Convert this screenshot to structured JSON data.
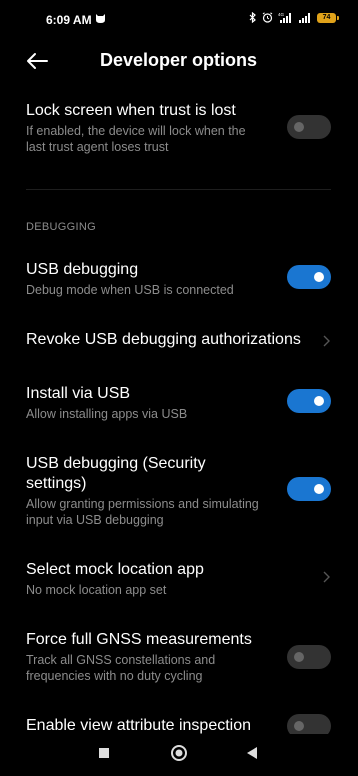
{
  "status_bar": {
    "time": "6:09 AM",
    "battery_level": "74",
    "icons": [
      "notification-icon",
      "bluetooth-icon",
      "alarm-icon",
      "signal-4g-icon",
      "signal-icon",
      "battery-icon"
    ]
  },
  "header": {
    "title": "Developer options",
    "back_icon": "arrow-left-icon"
  },
  "settings": {
    "lock_screen": {
      "title": "Lock screen when trust is lost",
      "subtitle_line1": "If enabled, the device will lock when the",
      "subtitle_line2": "last trust agent loses trust",
      "enabled": false
    },
    "section_debugging": "DEBUGGING",
    "usb_debugging": {
      "title": "USB debugging",
      "subtitle": "Debug mode when USB is connected",
      "enabled": true
    },
    "revoke_usb": {
      "title": "Revoke USB debugging authorizations"
    },
    "install_via_usb": {
      "title": "Install via USB",
      "subtitle": "Allow installing apps via USB",
      "enabled": true
    },
    "usb_debugging_security": {
      "title_line1": "USB debugging (Security",
      "title_line2": "settings)",
      "subtitle_line1": "Allow granting permissions and simulating",
      "subtitle_line2": "input via USB debugging",
      "enabled": true
    },
    "mock_location": {
      "title": "Select mock location app",
      "subtitle": "No mock location app set"
    },
    "gnss": {
      "title": "Force full GNSS measurements",
      "subtitle_line1": "Track all GNSS constellations and",
      "subtitle_line2": "frequencies with no duty cycling",
      "enabled": false
    },
    "view_attribute": {
      "title": "Enable view attribute inspection",
      "enabled": false
    }
  },
  "colors": {
    "background": "#000000",
    "toggle_on": "#1a76d1",
    "toggle_off": "#333333",
    "subtitle": "#8c8c8c"
  }
}
